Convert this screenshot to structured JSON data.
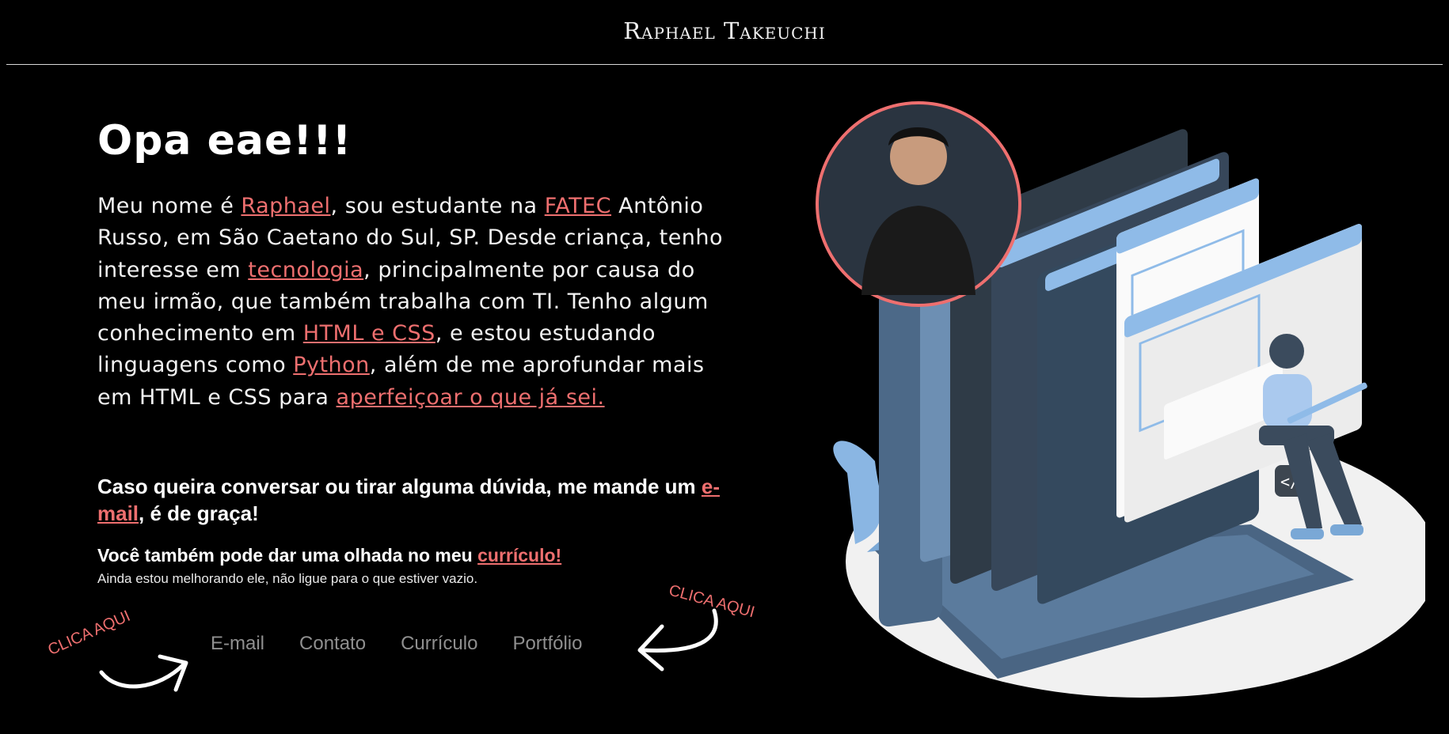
{
  "header": {
    "title": "Raphael Takeuchi"
  },
  "hero": {
    "title": "Opa eae!!!",
    "intro": {
      "t1": "Meu nome é ",
      "link_name": "Raphael",
      "t2": ", sou estudante na ",
      "link_fatec": "FATEC",
      "t3": " Antônio Russo, em São Caetano do Sul, SP. Desde criança, tenho interesse em ",
      "link_tech": "tecnologia",
      "t4": ", principalmente por causa do meu irmão, que também trabalha com TI. Tenho algum conhecimento em ",
      "link_html": "HTML e CSS",
      "t5": ", e estou estudando linguagens como ",
      "link_python": "Python",
      "t6": ", além de me aprofundar mais em HTML e CSS para ",
      "link_improve": "aperfeiçoar o que já sei."
    },
    "contact": {
      "t1": "Caso queira conversar ou tirar alguma dúvida, me mande um ",
      "link_email": "e-mail",
      "t2": ", é de graça!"
    },
    "cv": {
      "t1": "Você também pode dar uma olhada no meu ",
      "link": "currículo!"
    },
    "note": "Ainda estou melhorando ele, não ligue para o que estiver vazio."
  },
  "nav": {
    "items": [
      {
        "label": "E-mail"
      },
      {
        "label": "Contato"
      },
      {
        "label": "Currículo"
      },
      {
        "label": "Portfólio"
      }
    ]
  },
  "annotations": {
    "left": "CLICA AQUI",
    "right": "CLICA AQUI"
  },
  "colors": {
    "background": "#000000",
    "accent": "#ee6f6f",
    "nav_text": "#8f8f8f",
    "illustration_blue": "#5b8fc7"
  }
}
